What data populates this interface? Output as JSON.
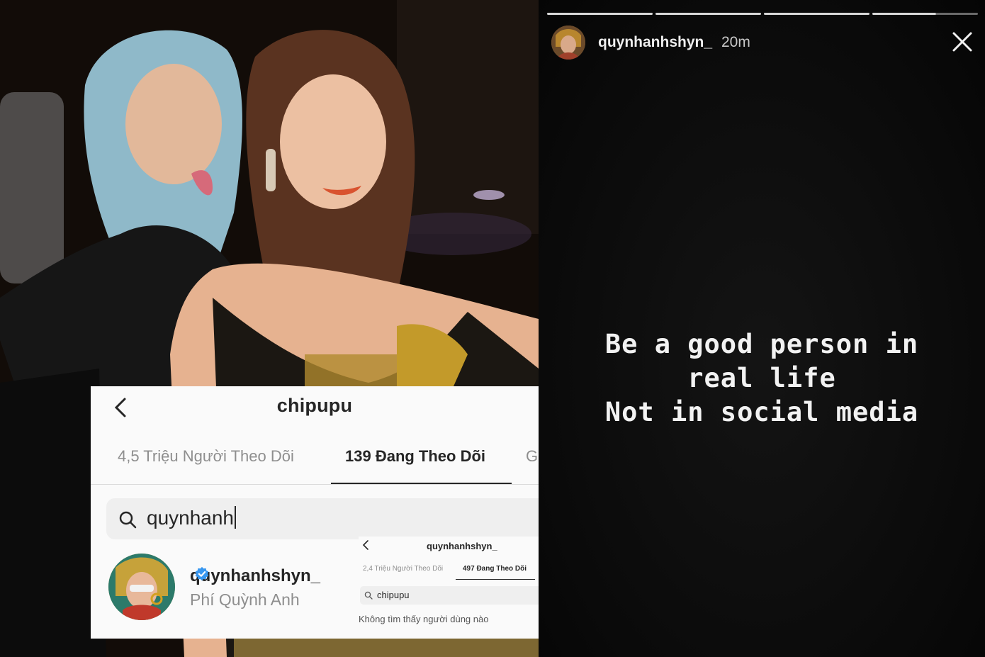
{
  "photo": {
    "description_icon": "photo-of-two-women"
  },
  "following_panel": {
    "title": "chipupu",
    "tabs": [
      {
        "label": "4,5 Triệu Người Theo Dõi"
      },
      {
        "label": "139 Đang Theo Dõi"
      },
      {
        "label": "G"
      }
    ],
    "search": {
      "value": "quynhanh"
    },
    "result": {
      "username": "quynhanhshyn_",
      "full_name": "Phí Quỳnh Anh"
    }
  },
  "mini_panel": {
    "title": "quynhanhshyn_",
    "tabs": [
      {
        "label": "2,4 Triệu Người Theo Dõi"
      },
      {
        "label": "497 Đang Theo Dõi"
      }
    ],
    "search": {
      "value": "chipupu"
    },
    "empty_message": "Không tìm thấy người dùng nào"
  },
  "story": {
    "username": "quynhanhshyn_",
    "time": "20m",
    "lines": [
      "Be a good person in",
      "real life",
      "Not in social media"
    ]
  },
  "colors": {
    "verified": "#3897f0",
    "text_dark": "#262626",
    "text_muted": "#8e8e8e"
  }
}
